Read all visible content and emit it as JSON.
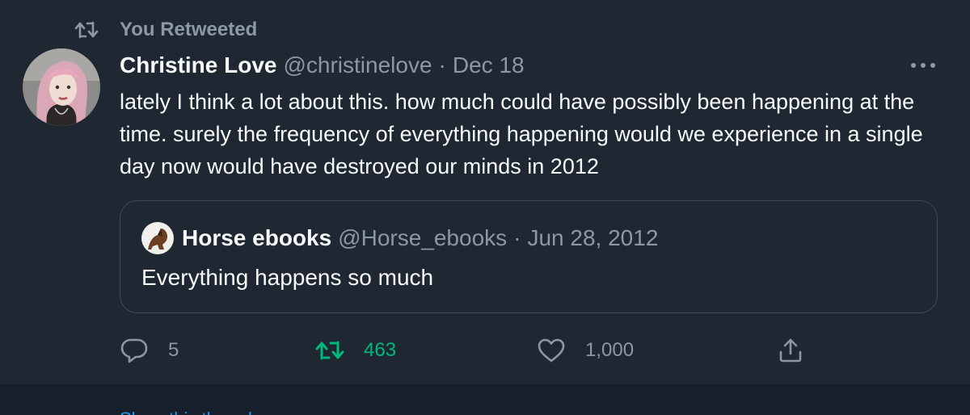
{
  "retweet_header": {
    "label": "You Retweeted",
    "icon": "retweet-icon"
  },
  "author": {
    "name": "Christine Love",
    "handle": "@christinelove",
    "separator": "·",
    "date": "Dec 18",
    "avatar_icon": "avatar-christinelove"
  },
  "more_icon": "more-options-icon",
  "tweet_text": "lately I think a lot about this. how much could have possibly been happening at the time. surely the frequency of everything happening would we experience in a single day now would have destroyed our minds in 2012",
  "quoted_tweet": {
    "name": "Horse ebooks",
    "handle": "@Horse_ebooks",
    "separator": "·",
    "date": "Jun 28, 2012",
    "text": "Everything happens so much",
    "avatar_icon": "avatar-horse-ebooks"
  },
  "actions": {
    "reply": {
      "count": "5",
      "icon": "reply-icon"
    },
    "retweet": {
      "count": "463",
      "icon": "retweet-icon"
    },
    "like": {
      "count": "1,000",
      "icon": "heart-icon"
    },
    "share": {
      "icon": "share-icon"
    }
  },
  "footer": {
    "show_thread": "Show this thread"
  },
  "colors": {
    "background": "#1e2732",
    "text_primary": "#f7f9f9",
    "text_secondary": "#8b98a5",
    "retweet_green": "#00ba7c",
    "link_blue": "#1d9bf0",
    "border": "#3d4a57"
  }
}
